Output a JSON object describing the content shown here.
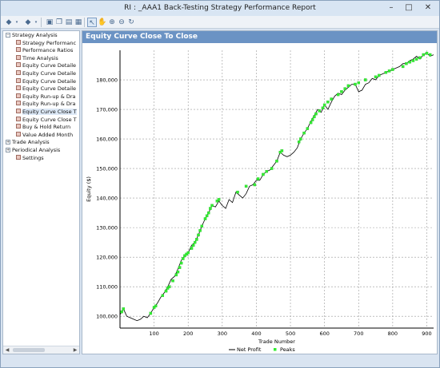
{
  "window": {
    "title": "RI : _AAA1 Back-Testing Strategy Performance Report",
    "minimize": "–",
    "maximize": "□",
    "close": "✕"
  },
  "toolbar": {
    "icons": [
      "back-arrow-icon",
      "forward-arrow-icon",
      "save-icon",
      "copy-icon",
      "print-icon",
      "export-icon",
      "pointer-icon",
      "pan-hand-icon",
      "zoom-in-icon",
      "zoom-out-icon",
      "refresh-icon"
    ]
  },
  "tree": [
    {
      "label": "Strategy Analysis",
      "level": 0,
      "expander": "−"
    },
    {
      "label": "Strategy Performanc",
      "level": 1
    },
    {
      "label": "Performance Ratios",
      "level": 1
    },
    {
      "label": "Time Analysis",
      "level": 1
    },
    {
      "label": "Equity Curve Detaile",
      "level": 1
    },
    {
      "label": "Equity Curve Detaile",
      "level": 1
    },
    {
      "label": "Equity Curve Detaile",
      "level": 1
    },
    {
      "label": "Equity Curve Detaile",
      "level": 1
    },
    {
      "label": "Equity Run-up & Dra",
      "level": 1
    },
    {
      "label": "Equity Run-up & Dra",
      "level": 1
    },
    {
      "label": "Equity Curve Close T",
      "level": 1,
      "selected": true
    },
    {
      "label": "Equity Curve Close T",
      "level": 1
    },
    {
      "label": "Buy & Hold Return",
      "level": 1
    },
    {
      "label": "Value Added Month",
      "level": 1
    },
    {
      "label": "Trade Analysis",
      "level": 0,
      "expander": "+"
    },
    {
      "label": "Periodical Analysis",
      "level": 0,
      "expander": "+"
    },
    {
      "label": "Settings",
      "level": 1
    }
  ],
  "panel": {
    "header": "Equity Curve Close To Close"
  },
  "chart_data": {
    "type": "line",
    "xlabel": "Trade Number",
    "ylabel": "Equity ($)",
    "xlim": [
      0,
      920
    ],
    "ylim": [
      96000,
      190000
    ],
    "xticks": [
      100,
      200,
      300,
      400,
      500,
      600,
      700,
      800,
      900
    ],
    "yticks": [
      100000,
      110000,
      120000,
      130000,
      140000,
      150000,
      160000,
      170000,
      180000
    ],
    "ytick_labels": [
      "100,000",
      "110,000",
      "120,000",
      "130,000",
      "140,000",
      "150,000",
      "160,000",
      "170,000",
      "180,000"
    ],
    "grid": true,
    "legend": "bottom-center",
    "colors": {
      "net_profit": "#000000",
      "peaks": "#33ee33"
    },
    "series": [
      {
        "name": "Net Profit",
        "x": [
          0,
          10,
          20,
          30,
          40,
          50,
          60,
          70,
          80,
          90,
          100,
          110,
          120,
          130,
          140,
          150,
          160,
          170,
          180,
          190,
          200,
          210,
          220,
          230,
          240,
          250,
          260,
          270,
          280,
          290,
          300,
          310,
          320,
          330,
          340,
          350,
          360,
          370,
          380,
          390,
          400,
          410,
          420,
          430,
          440,
          450,
          460,
          470,
          480,
          490,
          500,
          510,
          520,
          530,
          540,
          550,
          560,
          570,
          580,
          590,
          600,
          610,
          620,
          630,
          640,
          650,
          660,
          670,
          680,
          690,
          700,
          710,
          720,
          730,
          740,
          750,
          760,
          770,
          780,
          790,
          800,
          810,
          820,
          830,
          840,
          850,
          860,
          870,
          880,
          890,
          900,
          910,
          920
        ],
        "values": [
          100500,
          102500,
          100000,
          99500,
          99000,
          98500,
          99000,
          100000,
          99500,
          101000,
          103000,
          104500,
          106500,
          108000,
          110000,
          112500,
          113500,
          116000,
          119000,
          120500,
          121500,
          124000,
          125000,
          127500,
          130500,
          133000,
          135000,
          137500,
          137000,
          139000,
          137500,
          136500,
          139500,
          138500,
          142000,
          141000,
          140000,
          141500,
          144000,
          144500,
          146000,
          146000,
          148000,
          149000,
          149500,
          151000,
          152500,
          155500,
          154500,
          154000,
          154500,
          155500,
          157000,
          160000,
          162000,
          163500,
          166000,
          168000,
          170000,
          169000,
          171500,
          170000,
          172500,
          174500,
          175500,
          175000,
          176500,
          177500,
          178500,
          178500,
          176000,
          176500,
          178500,
          179000,
          180500,
          180000,
          181500,
          182000,
          182500,
          183000,
          183500,
          184000,
          184500,
          185500,
          185500,
          186500,
          187000,
          188000,
          187000,
          188500,
          189000,
          188000,
          188500
        ]
      },
      {
        "name": "Peaks",
        "x": [
          5,
          10,
          90,
          100,
          105,
          125,
          135,
          140,
          145,
          155,
          165,
          170,
          175,
          180,
          185,
          190,
          195,
          200,
          210,
          215,
          220,
          225,
          230,
          235,
          240,
          250,
          255,
          260,
          265,
          270,
          285,
          290,
          345,
          370,
          395,
          405,
          420,
          430,
          445,
          460,
          470,
          475,
          525,
          530,
          540,
          550,
          560,
          565,
          570,
          575,
          585,
          595,
          600,
          610,
          620,
          640,
          650,
          660,
          670,
          690,
          700,
          720,
          750,
          760,
          780,
          790,
          800,
          830,
          840,
          850,
          860,
          870,
          880,
          890,
          900,
          910
        ],
        "values": [
          101500,
          102500,
          101000,
          103000,
          103500,
          107000,
          108500,
          109500,
          110000,
          112000,
          114000,
          115000,
          116500,
          118000,
          119500,
          120500,
          121000,
          121500,
          123000,
          124000,
          125000,
          126000,
          127500,
          129000,
          130500,
          133000,
          134000,
          135000,
          136500,
          137500,
          139000,
          139500,
          142000,
          144000,
          144500,
          146500,
          148000,
          149000,
          150000,
          152500,
          155500,
          156000,
          159000,
          160000,
          162000,
          163500,
          165500,
          166500,
          167500,
          168500,
          169500,
          170500,
          171500,
          172500,
          173500,
          175000,
          176000,
          177000,
          178000,
          178500,
          179000,
          180000,
          181000,
          181500,
          182500,
          183000,
          183500,
          184500,
          185500,
          186000,
          186500,
          187000,
          187500,
          188500,
          189000,
          188500
        ]
      }
    ]
  }
}
